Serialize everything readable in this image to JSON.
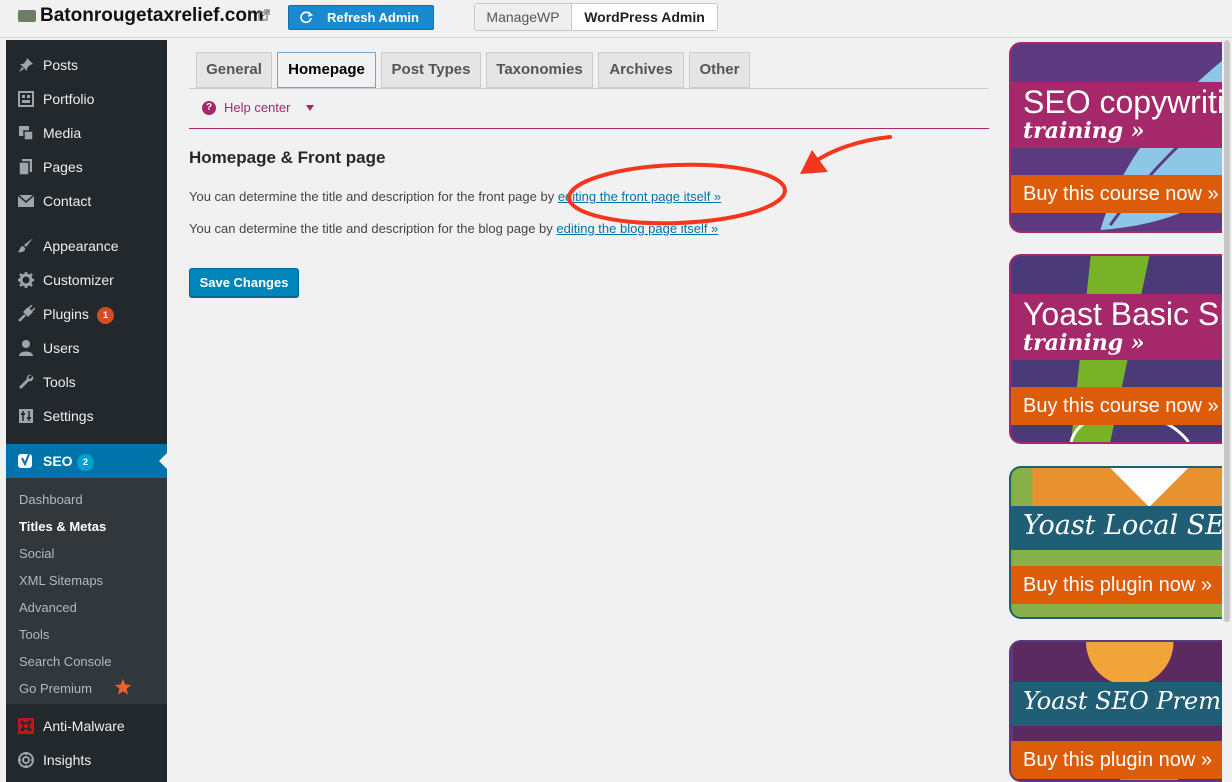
{
  "topbar": {
    "site_title": "Batonrougetaxrelief.com",
    "refresh_label": "Refresh Admin",
    "managewp_label": "ManageWP",
    "wpadmin_label": "WordPress Admin"
  },
  "sidebar": {
    "items": [
      {
        "label": "Posts",
        "icon": "pin-icon"
      },
      {
        "label": "Portfolio",
        "icon": "portfolio-icon"
      },
      {
        "label": "Media",
        "icon": "media-icon"
      },
      {
        "label": "Pages",
        "icon": "pages-icon"
      },
      {
        "label": "Contact",
        "icon": "mail-icon"
      },
      {
        "label": "Appearance",
        "icon": "brush-icon"
      },
      {
        "label": "Customizer",
        "icon": "gear-icon"
      },
      {
        "label": "Plugins",
        "icon": "plug-icon",
        "badge": "1"
      },
      {
        "label": "Users",
        "icon": "user-icon"
      },
      {
        "label": "Tools",
        "icon": "wrench-icon"
      },
      {
        "label": "Settings",
        "icon": "settings-icon"
      },
      {
        "label": "SEO",
        "icon": "yoast-icon",
        "badge": "2"
      },
      {
        "label": "Anti-Malware",
        "icon": "shield-icon"
      },
      {
        "label": "Insights",
        "icon": "insights-icon"
      }
    ],
    "seo_submenu": [
      "Dashboard",
      "Titles & Metas",
      "Social",
      "XML Sitemaps",
      "Advanced",
      "Tools",
      "Search Console",
      "Go Premium"
    ],
    "active_submenu": "Titles & Metas"
  },
  "tabs": [
    "General",
    "Homepage",
    "Post Types",
    "Taxonomies",
    "Archives",
    "Other"
  ],
  "active_tab": "Homepage",
  "help_center": "Help center",
  "section_title": "Homepage & Front page",
  "para1": {
    "text": "You can determine the title and description for the front page by ",
    "link": "editing the front page itself »"
  },
  "para2": {
    "text": "You can determine the title and description for the blog page by ",
    "link": "editing the blog page itself »"
  },
  "save_button": "Save Changes",
  "ads": [
    {
      "title": "SEO copywriting",
      "subtitle": "training »",
      "cta": "Buy this course now »"
    },
    {
      "title": "Yoast Basic SEO",
      "subtitle": "training »",
      "cta": "Buy this course now »"
    },
    {
      "title": "Yoast Local SEO",
      "cta": "Buy this plugin now »"
    },
    {
      "title": "Yoast SEO Premium",
      "cta": "Buy this plugin now »"
    }
  ],
  "colors": {
    "sidebar_bg": "#23282d",
    "seo_active": "#0073aa",
    "yoast_purple": "#a4286a",
    "cta_orange": "#dc5c0a",
    "annotation_red": "#f5361e"
  }
}
